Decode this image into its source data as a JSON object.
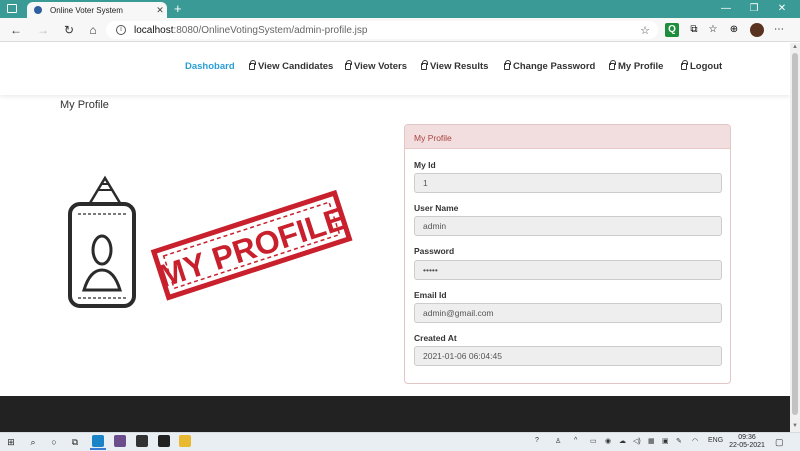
{
  "browser": {
    "tab_title": "Online Voter System",
    "tab_close": "✕",
    "new_tab": "+",
    "url_host": "localhost",
    "url_rest": ":8080/OnlineVotingSystem/admin-profile.jsp",
    "window_controls": [
      "—",
      "❐",
      "✕"
    ]
  },
  "nav": {
    "items": [
      {
        "label": "Dashobard",
        "active": true
      },
      {
        "label": "View Candidates"
      },
      {
        "label": "View Voters"
      },
      {
        "label": "View Results"
      },
      {
        "label": "Change Password"
      },
      {
        "label": "My Profile"
      },
      {
        "label": "Logout"
      }
    ],
    "active_color": "#2a9fd6"
  },
  "page": {
    "title": "My Profile",
    "illustration_text": "MY PROFILE"
  },
  "panel": {
    "heading": "My Profile",
    "fields": [
      {
        "label": "My Id",
        "value": "1"
      },
      {
        "label": "User Name",
        "value": "admin"
      },
      {
        "label": "Password",
        "value": "•••••"
      },
      {
        "label": "Email Id",
        "value": "admin@gmail.com"
      },
      {
        "label": "Created At",
        "value": "2021-01-06 06:04:45"
      }
    ]
  },
  "taskbar": {
    "language": "ENG",
    "time": "09:36",
    "date": "22-05-2021"
  },
  "colors": {
    "tabstrip": "#3a9b96",
    "panel_head_bg": "#f2dede",
    "panel_head_text": "#a94442",
    "stamp_red": "#c8202c",
    "footer": "#222222"
  }
}
